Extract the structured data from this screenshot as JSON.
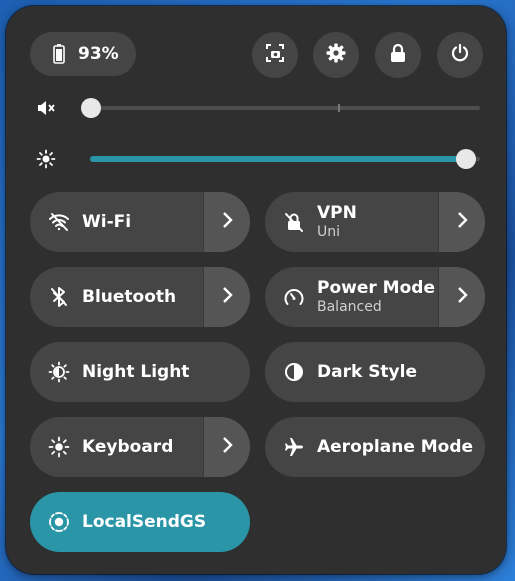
{
  "battery": {
    "percent": "93%",
    "level": 0.93
  },
  "header_buttons": [
    {
      "name": "screenshot-button",
      "icon": "screenshot-icon"
    },
    {
      "name": "settings-button",
      "icon": "gear-icon"
    },
    {
      "name": "lock-button",
      "icon": "lock-icon"
    },
    {
      "name": "power-button",
      "icon": "power-icon"
    }
  ],
  "volume": {
    "icon": "volume-muted-icon",
    "level": 0.0
  },
  "brightness": {
    "icon": "brightness-icon",
    "level": 1.0
  },
  "tiles": {
    "wifi": {
      "label": "Wi-Fi",
      "icon": "wifi-off-icon",
      "active": false,
      "has_menu": true
    },
    "vpn": {
      "label": "VPN",
      "subtitle": "Uni",
      "icon": "vpn-icon",
      "active": false,
      "has_menu": true
    },
    "bluetooth": {
      "label": "Bluetooth",
      "icon": "bluetooth-off-icon",
      "active": false,
      "has_menu": true
    },
    "power_mode": {
      "label": "Power Mode",
      "subtitle": "Balanced",
      "icon": "gauge-icon",
      "active": false,
      "has_menu": true
    },
    "night_light": {
      "label": "Night Light",
      "icon": "night-light-icon",
      "active": false
    },
    "dark_style": {
      "label": "Dark Style",
      "icon": "dark-style-icon",
      "active": false
    },
    "keyboard": {
      "label": "Keyboard",
      "icon": "keyboard-brightness-icon",
      "active": false,
      "has_menu": true
    },
    "aeroplane": {
      "label": "Aeroplane Mode",
      "icon": "airplane-icon",
      "active": false
    },
    "localsend": {
      "label": "LocalSendGS",
      "icon": "localsend-icon",
      "active": true
    }
  },
  "colors": {
    "accent": "#2a95a6",
    "panel": "#2f2f2f",
    "tile": "#454545"
  }
}
